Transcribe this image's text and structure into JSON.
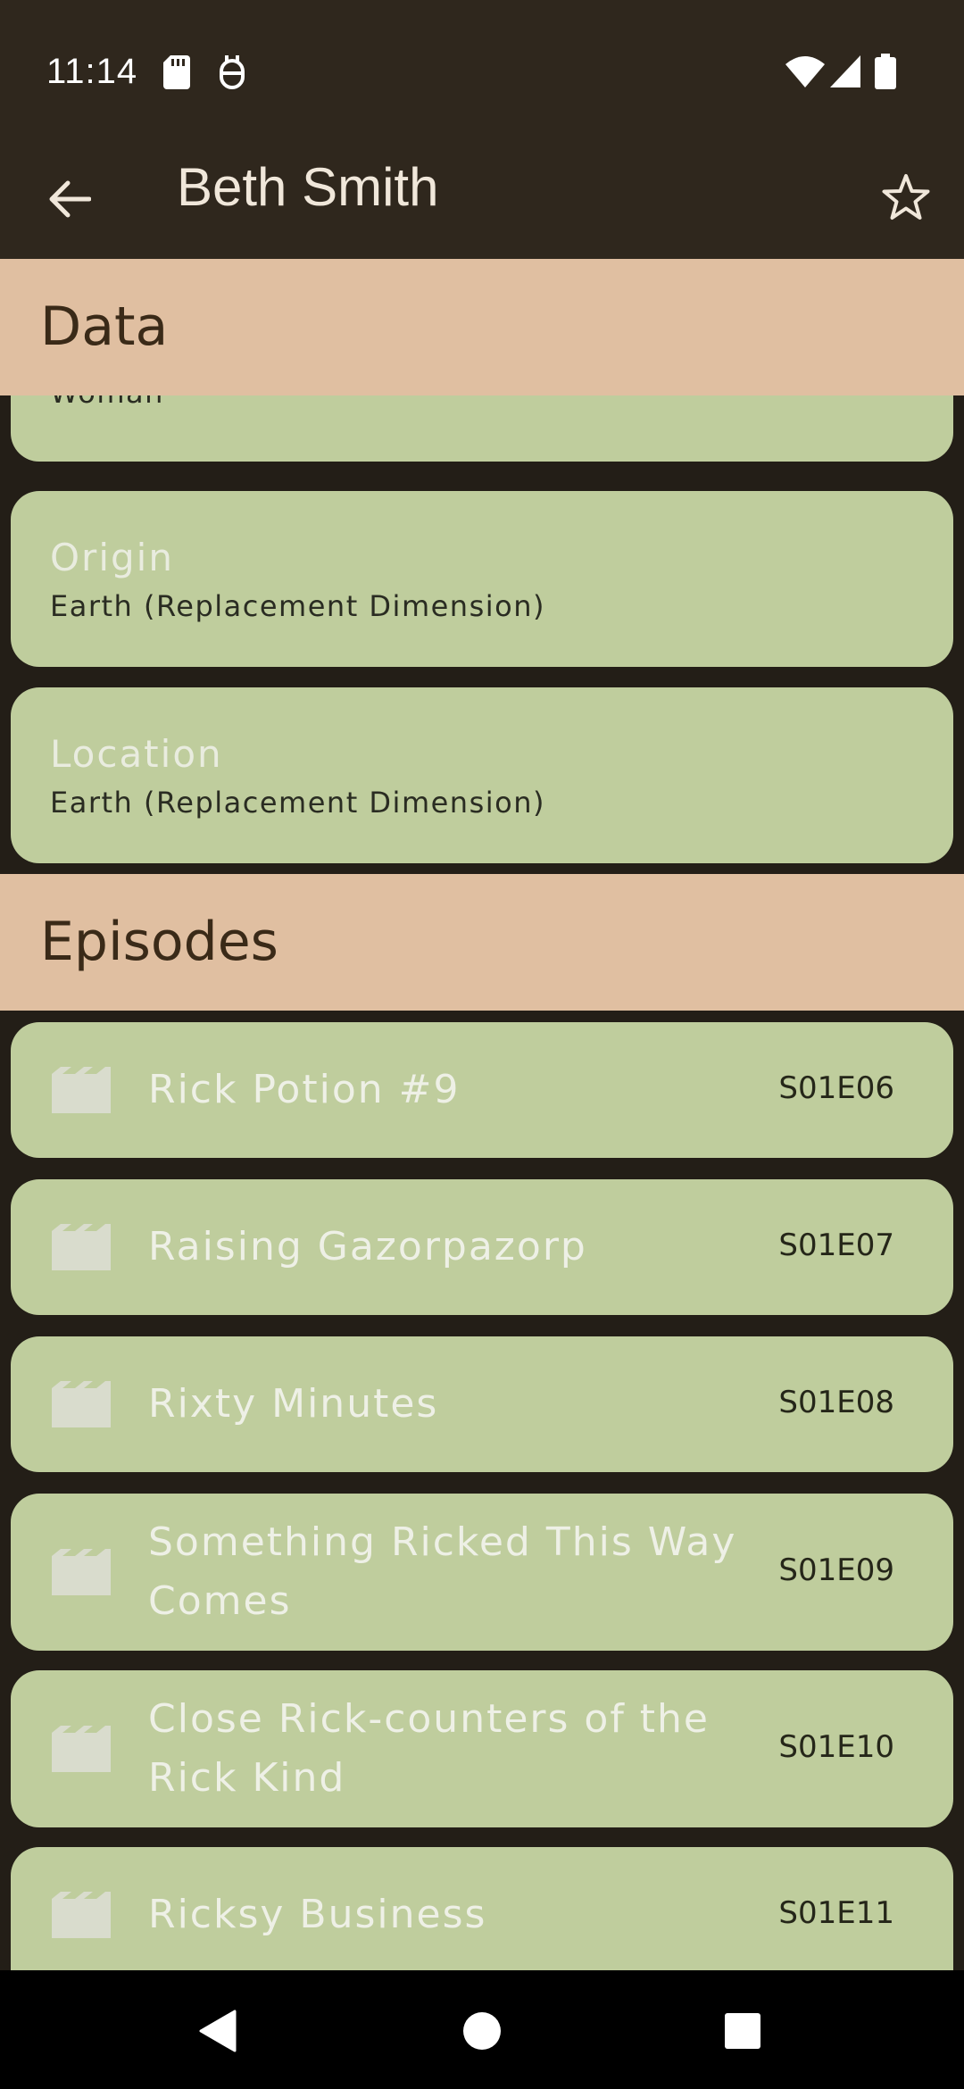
{
  "status_bar": {
    "time": "11:14",
    "icons_left": [
      "sd-card-icon",
      "silent-mode-icon"
    ],
    "icons_right": [
      "wifi-icon",
      "signal-icon",
      "battery-icon"
    ]
  },
  "app_bar": {
    "title": "Beth Smith",
    "back_icon": "arrow-back-icon",
    "favorite_icon": "star-outline-icon"
  },
  "sections": {
    "data_header": "Data",
    "episodes_header": "Episodes"
  },
  "data_cards": {
    "gender_value": "Woman",
    "origin": {
      "label": "Origin",
      "value": "Earth (Replacement Dimension)"
    },
    "location": {
      "label": "Location",
      "value": "Earth (Replacement Dimension)"
    }
  },
  "episodes": [
    {
      "title": "Rick Potion #9",
      "code": "S01E06"
    },
    {
      "title": "Raising Gazorpazorp",
      "code": "S01E07"
    },
    {
      "title": "Rixty Minutes",
      "code": "S01E08"
    },
    {
      "title": "Something Ricked This Way Comes",
      "code": "S01E09"
    },
    {
      "title": "Close Rick-counters of the Rick Kind",
      "code": "S01E10"
    },
    {
      "title": "Ricksy Business",
      "code": "S01E11"
    }
  ],
  "colors": {
    "app_bar": "#2f271d",
    "section_header": "#e0bfa1",
    "card": "#bfcd9d",
    "background": "#231e17"
  },
  "nav_bar": {
    "back_icon": "nav-back-triangle-icon",
    "home_icon": "nav-home-circle-icon",
    "recents_icon": "nav-recents-square-icon"
  }
}
